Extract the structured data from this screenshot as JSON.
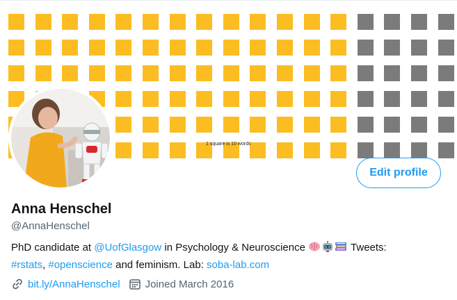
{
  "banner": {
    "caption": "1 square is 10 words",
    "grid_rows": 6,
    "grid_cols": 17,
    "yellow_columns": 13,
    "colors": {
      "yellow": "#fcbd22",
      "gray": "#7b7b7b"
    }
  },
  "profile": {
    "name": "Anna Henschel",
    "handle": "@AnnaHenschel",
    "edit_label": "Edit profile",
    "bio": {
      "t1": "PhD candidate at ",
      "mention": "@UofGlasgow",
      "t2": " in Psychology & Neuroscience ",
      "t3": " Tweets: ",
      "hashtag1": "#rstats",
      "t4": ", ",
      "hashtag2": "#openscience",
      "t5": " and feminism. Lab: ",
      "lab_link": "soba-lab.com",
      "emojis": [
        "brain-emoji",
        "robot-emoji",
        "books-emoji"
      ]
    },
    "website": "bit.ly/AnnaHenschel",
    "joined": "Joined March 2016"
  },
  "colors": {
    "accent": "#1d9bf0",
    "secondary_text": "#536471"
  }
}
